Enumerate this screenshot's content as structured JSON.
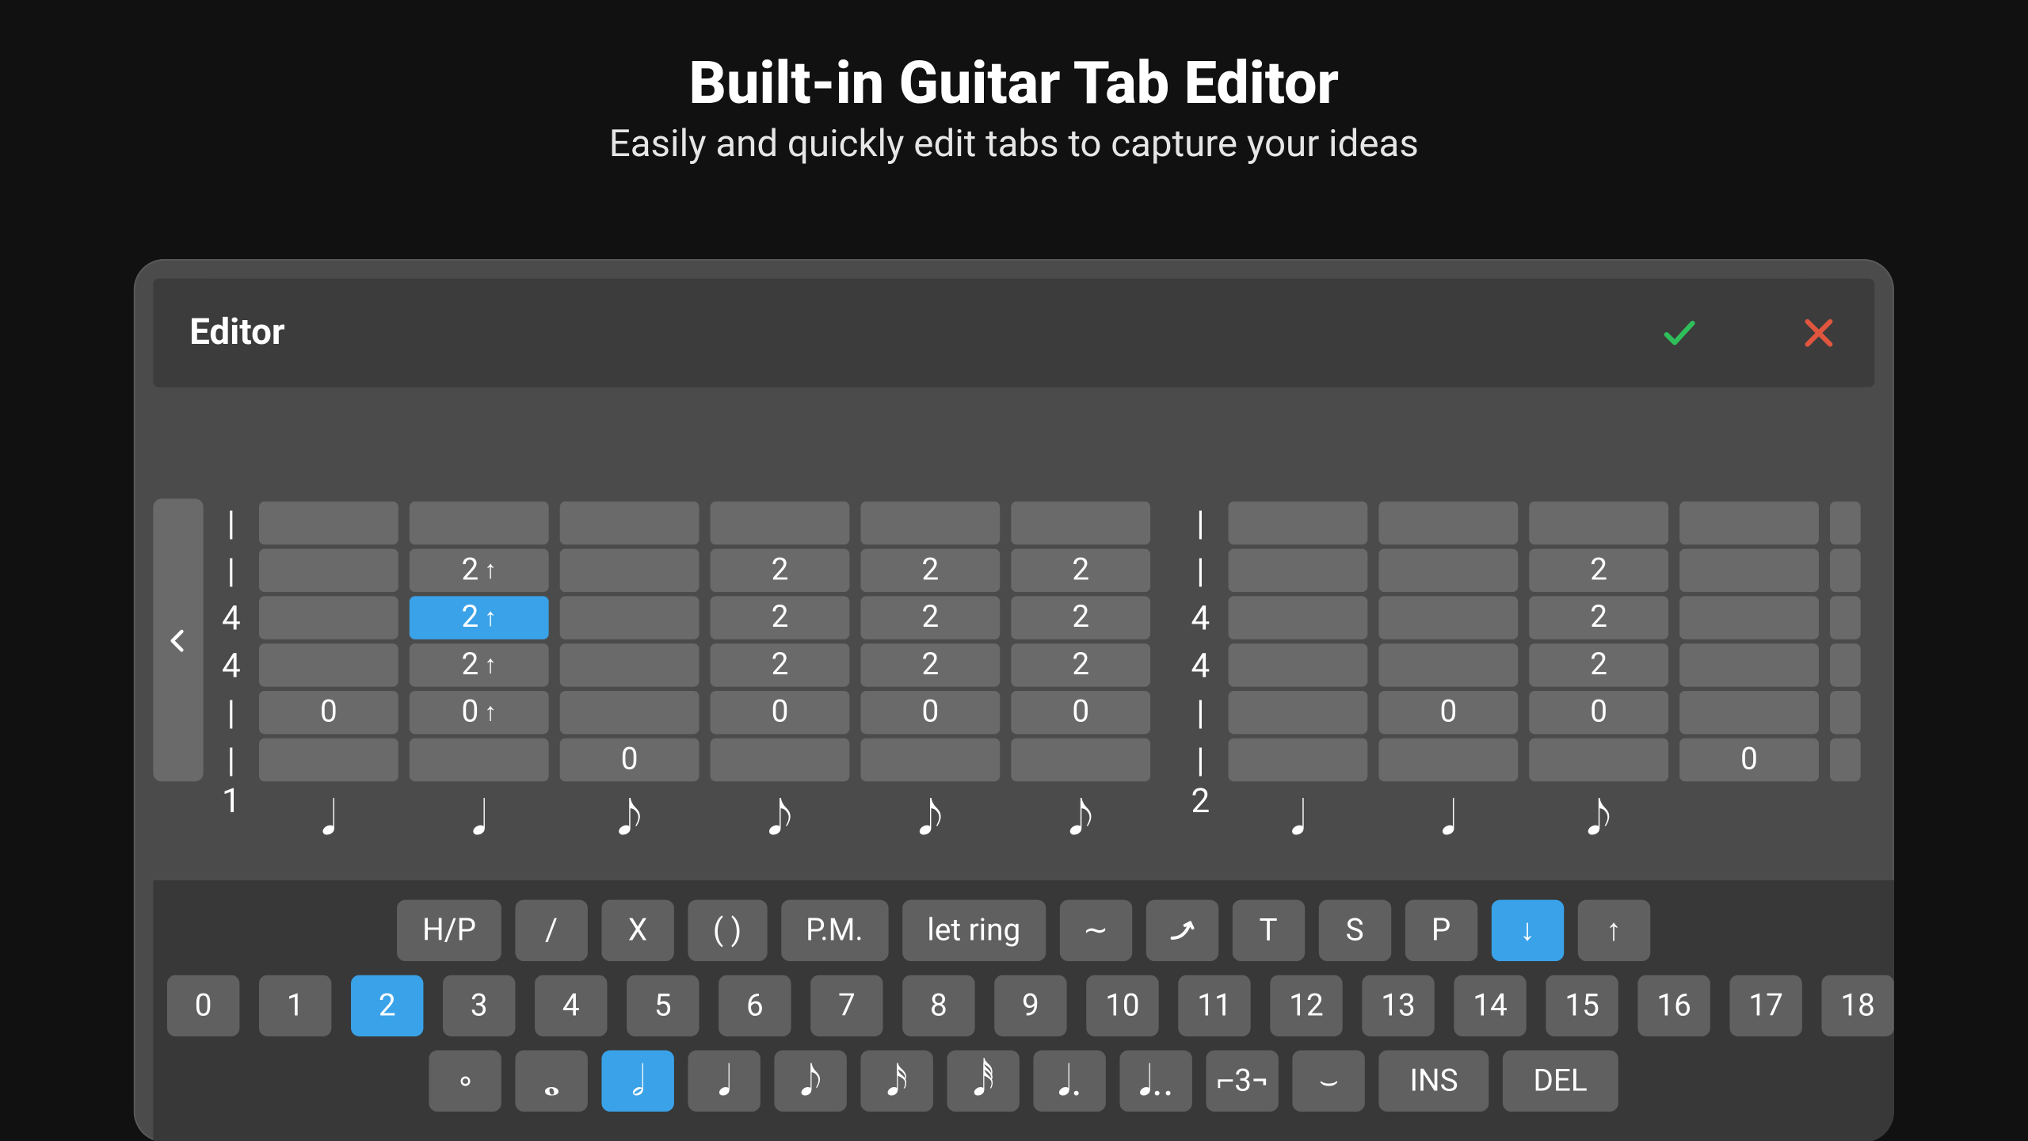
{
  "hero": {
    "title": "Built-in Guitar Tab Editor",
    "subtitle": "Easily and quickly edit tabs to capture your ideas"
  },
  "window": {
    "title": "Editor"
  },
  "timesig": {
    "bar1_top": "|",
    "bar1_b": "|",
    "bar1_c": "4",
    "bar1_d": "4",
    "bar1_e": "|",
    "bar1_f": "|",
    "bar1_num": "1",
    "bar2_top": "|",
    "bar2_b": "|",
    "bar2_c": "4",
    "bar2_d": "4",
    "bar2_e": "|",
    "bar2_f": "|",
    "bar2_num": "2"
  },
  "grid": {
    "rows": [
      {
        "c": [
          "",
          "",
          "",
          "",
          "",
          "",
          "",
          "",
          "",
          "",
          ""
        ]
      },
      {
        "c": [
          "",
          "2↑",
          "",
          "2",
          "2",
          "2",
          "",
          "",
          "2",
          "",
          ""
        ]
      },
      {
        "c": [
          "",
          "2↑",
          "",
          "2",
          "2",
          "2",
          "",
          "",
          "2",
          "",
          ""
        ],
        "sel": 1
      },
      {
        "c": [
          "",
          "2↑",
          "",
          "2",
          "2",
          "2",
          "",
          "",
          "2",
          "",
          ""
        ]
      },
      {
        "c": [
          "0",
          "0↑",
          "",
          "0",
          "0",
          "0",
          "",
          "0",
          "0",
          "",
          ""
        ]
      },
      {
        "c": [
          "",
          "",
          "0",
          "",
          "",
          "",
          "",
          "",
          "",
          "0",
          ""
        ]
      }
    ]
  },
  "rhythm": {
    "bar1": [
      "q",
      "q",
      "e",
      "e",
      "e",
      "e"
    ],
    "bar2": [
      "q",
      "q",
      "e"
    ]
  },
  "tech_buttons": [
    "H/P",
    "/",
    "X",
    "( )",
    "P.M.",
    "let ring",
    "∼",
    "↗",
    "T",
    "S",
    "P",
    "↓",
    "↑"
  ],
  "tech_selected": 11,
  "frets": [
    "0",
    "1",
    "2",
    "3",
    "4",
    "5",
    "6",
    "7",
    "8",
    "9",
    "10",
    "11",
    "12",
    "13",
    "14",
    "15",
    "16",
    "17",
    "18"
  ],
  "fret_selected": 2,
  "dur_buttons": [
    "∘",
    "𝅝",
    "𝅗𝅥",
    "𝅘𝅥",
    "𝅘𝅥𝅮",
    "𝅘𝅥𝅯",
    "𝅘𝅥𝅰",
    "𝅘𝅥.",
    "𝅘𝅥..",
    "⌐3¬",
    "⌣",
    "INS",
    "DEL"
  ],
  "dur_selected": 2
}
